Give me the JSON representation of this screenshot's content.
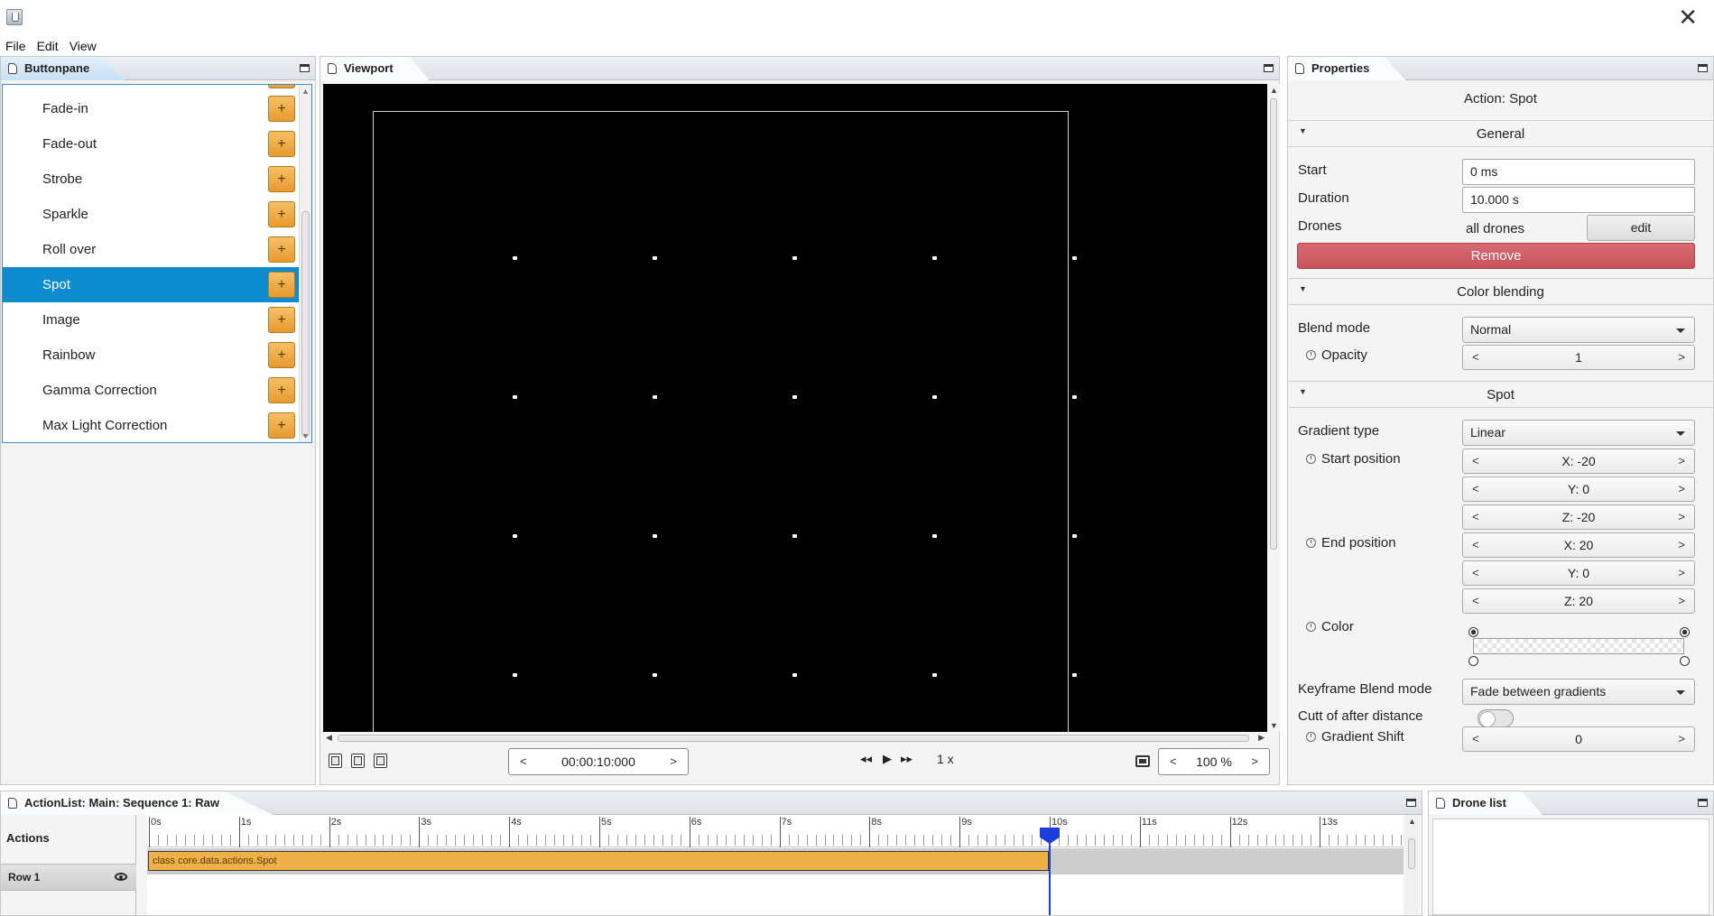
{
  "menu": [
    "File",
    "Edit",
    "View"
  ],
  "panels": {
    "buttonpane": "Buttonpane",
    "viewport": "Viewport",
    "properties": "Properties",
    "actionlist": "ActionList: Main: Sequence 1: Raw",
    "dronelist": "Drone list"
  },
  "buttonpane": {
    "items": [
      "Fade-in",
      "Fade-out",
      "Strobe",
      "Sparkle",
      "Roll over",
      "Spot",
      "Image",
      "Rainbow",
      "Gamma Correction",
      "Max Light Correction"
    ],
    "selected": "Spot",
    "add_label": "+"
  },
  "viewport": {
    "time": "00:00:10:000",
    "speed": "1 x",
    "zoom": "100 %",
    "prev": "<",
    "next": ">",
    "rewind": "◂◂",
    "play": "▶",
    "forward": "▸▸",
    "drone_grid": {
      "cols": 5,
      "rows": 4
    }
  },
  "properties": {
    "title": "Action: Spot",
    "general": {
      "header": "General",
      "start_label": "Start",
      "start_value": "0 ms",
      "duration_label": "Duration",
      "duration_value": "10.000 s",
      "drones_label": "Drones",
      "drones_value": "all drones",
      "edit_label": "edit",
      "remove_label": "Remove"
    },
    "color_blending": {
      "header": "Color blending",
      "blend_label": "Blend mode",
      "blend_value": "Normal",
      "opacity_label": "Opacity",
      "opacity_value": "1"
    },
    "spot": {
      "header": "Spot",
      "gradient_label": "Gradient type",
      "gradient_value": "Linear",
      "start_pos_label": "Start position",
      "start_x": "X: -20",
      "start_y": "Y: 0",
      "start_z": "Z: -20",
      "end_pos_label": "End position",
      "end_x": "X: 20",
      "end_y": "Y: 0",
      "end_z": "Z: 20",
      "color_label": "Color",
      "kf_blend_label": "Keyframe Blend mode",
      "kf_blend_value": "Fade between gradients",
      "cutoff_label": "Cutt of after distance",
      "shift_label": "Gradient Shift",
      "shift_value": "0"
    }
  },
  "actionlist": {
    "actions_header": "Actions",
    "row_label": "Row 1",
    "action_label": "class core.data.actions.Spot",
    "ticks": [
      "0s",
      "1s",
      "2s",
      "3s",
      "4s",
      "5s",
      "6s",
      "7s",
      "8s",
      "9s",
      "10s",
      "11s",
      "12s",
      "13s"
    ],
    "playhead_seconds": 10
  },
  "colors": {
    "selection": "#0d8ccf",
    "accent_orange": "#f0b048",
    "remove_red": "#c9525c",
    "playhead_blue": "#1d3de0"
  }
}
